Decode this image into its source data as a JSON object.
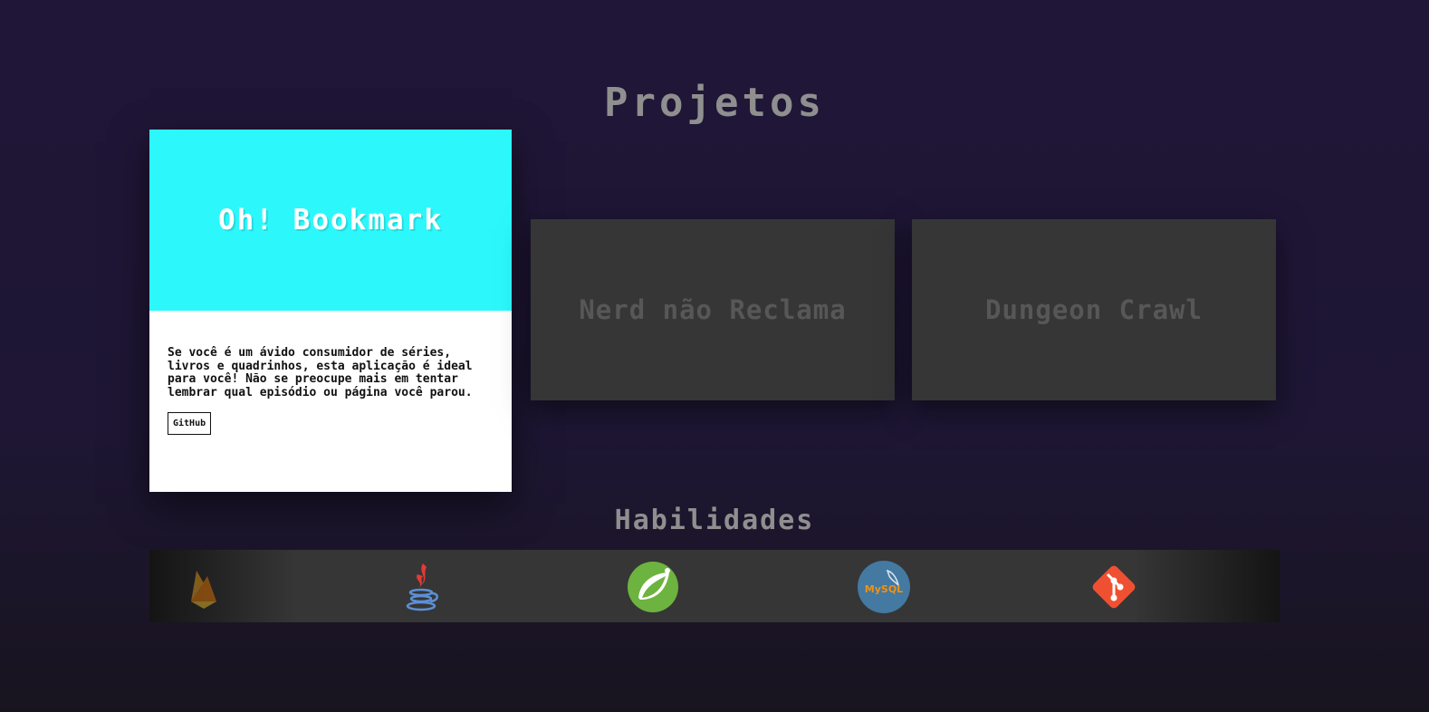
{
  "sections": {
    "projects_title": "Projetos",
    "skills_title": "Habilidades"
  },
  "projects": {
    "active": {
      "title": "Oh! Bookmark",
      "description": "Se você é um ávido consumidor de séries, livros e quadrinhos, esta aplicação é ideal para você! Não se preocupe mais em tentar lembrar qual episódio ou página você parou.",
      "button_label": "GitHub",
      "accent_color": "#2cf8fc"
    },
    "others": [
      {
        "title": "Nerd não Reclama"
      },
      {
        "title": "Dungeon Crawl"
      }
    ]
  },
  "skills": {
    "icons": [
      "firebase-icon",
      "java-icon",
      "spring-icon",
      "mysql-icon",
      "git-icon"
    ],
    "mysql_label": "MySQL"
  },
  "colors": {
    "background": "#201638",
    "title": "#8f8f8f",
    "inactive_card": "#363636",
    "inactive_text": "#575757"
  }
}
